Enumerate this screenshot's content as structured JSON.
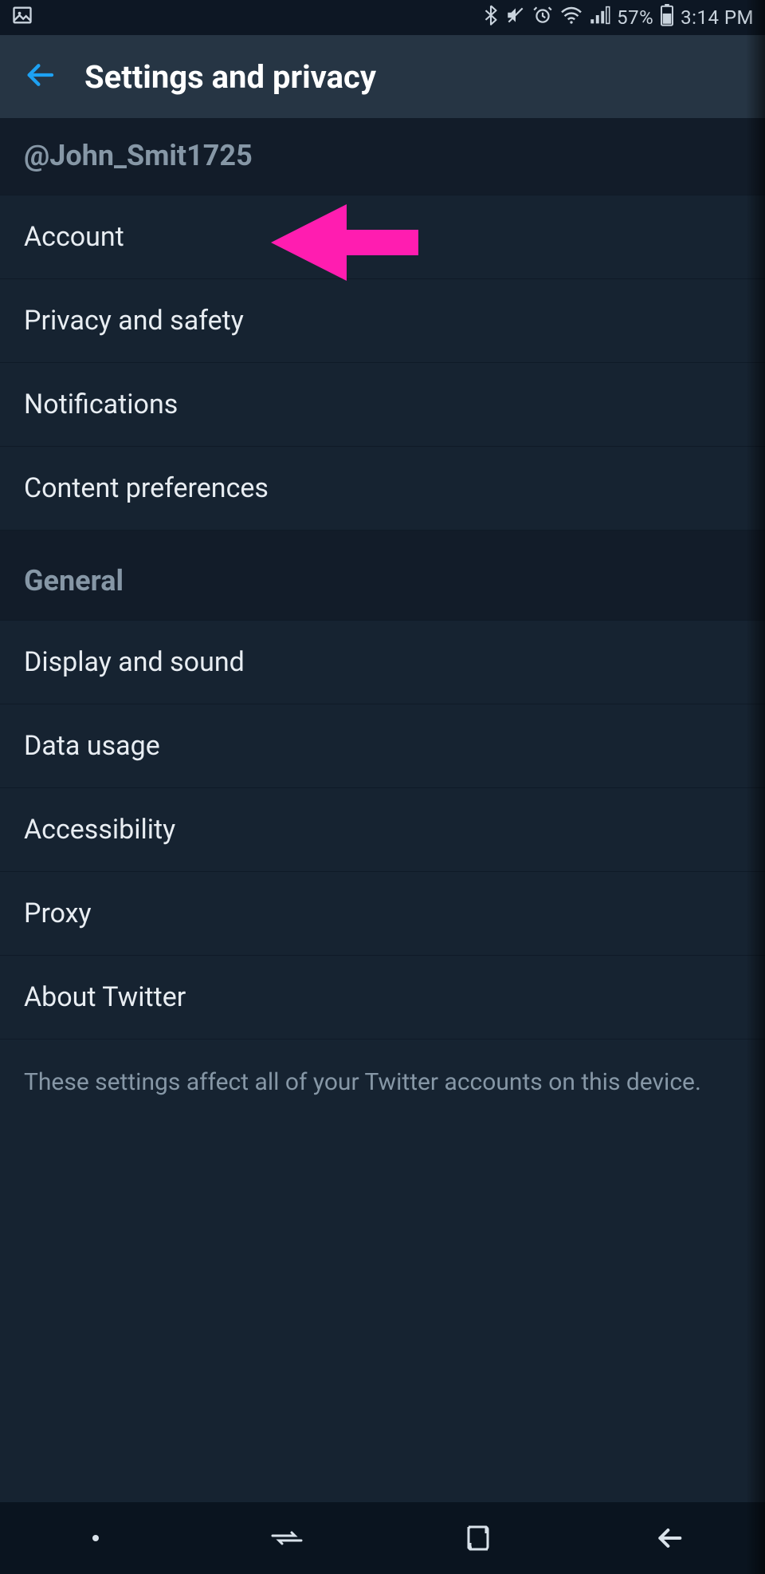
{
  "status": {
    "battery_pct": "57%",
    "time": "3:14 PM"
  },
  "header": {
    "title": "Settings and privacy"
  },
  "account_section": {
    "username": "@John_Smit1725",
    "items": [
      {
        "label": "Account"
      },
      {
        "label": "Privacy and safety"
      },
      {
        "label": "Notifications"
      },
      {
        "label": "Content preferences"
      }
    ]
  },
  "general_section": {
    "title": "General",
    "items": [
      {
        "label": "Display and sound"
      },
      {
        "label": "Data usage"
      },
      {
        "label": "Accessibility"
      },
      {
        "label": "Proxy"
      },
      {
        "label": "About Twitter"
      }
    ]
  },
  "footer_note": "These settings affect all of your Twitter accounts on this device."
}
